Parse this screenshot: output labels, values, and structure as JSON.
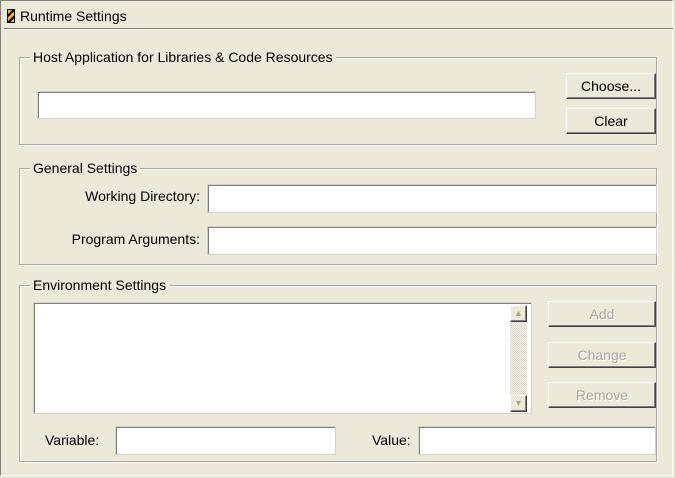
{
  "window": {
    "title": "Runtime Settings",
    "icon": "stripe-icon"
  },
  "host_app": {
    "legend": "Host Application for Libraries & Code Resources",
    "path_value": "",
    "choose_label": "Choose...",
    "clear_label": "Clear"
  },
  "general": {
    "legend": "General Settings",
    "working_dir_label": "Working Directory:",
    "working_dir_value": "",
    "program_args_label": "Program Arguments:",
    "program_args_value": ""
  },
  "environment": {
    "legend": "Environment Settings",
    "add_label": "Add",
    "change_label": "Change",
    "remove_label": "Remove",
    "variable_label": "Variable:",
    "variable_value": "",
    "value_label": "Value:",
    "value_value": "",
    "scroll_up": "▲",
    "scroll_down": "▼"
  }
}
